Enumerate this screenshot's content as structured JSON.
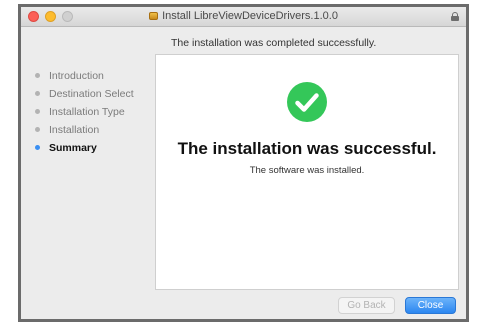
{
  "window": {
    "title": "Install LibreViewDeviceDrivers.1.0.0",
    "title_icon": "package-icon"
  },
  "status_line": "The installation was completed successfully.",
  "steps": [
    {
      "label": "Introduction",
      "active": false
    },
    {
      "label": "Destination Select",
      "active": false
    },
    {
      "label": "Installation Type",
      "active": false
    },
    {
      "label": "Installation",
      "active": false
    },
    {
      "label": "Summary",
      "active": true
    }
  ],
  "main": {
    "icon": "success-check-icon",
    "headline": "The installation was successful.",
    "subtext": "The software was installed."
  },
  "buttons": {
    "go_back": "Go Back",
    "close": "Close"
  },
  "colors": {
    "success": "#34c759",
    "accent": "#2c86f0",
    "frame_border": "#6b6b6b"
  }
}
